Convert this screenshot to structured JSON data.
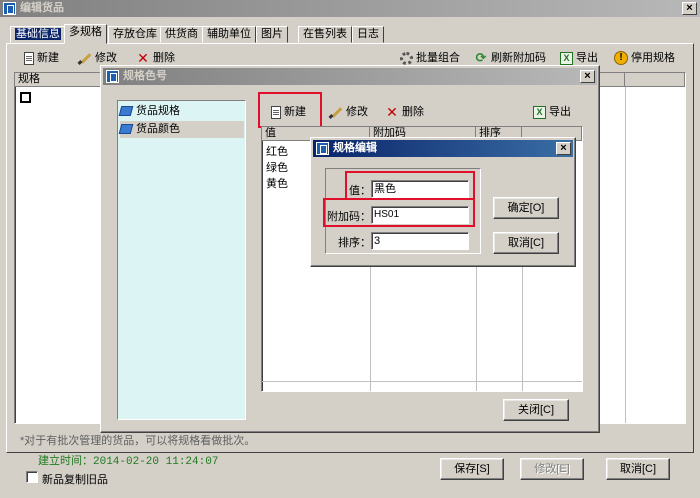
{
  "main_window": {
    "title": "编辑货品",
    "tabs": [
      "基础信息",
      "多规格",
      "存放仓库",
      "供货商",
      "辅助单位",
      "图片",
      "在售列表",
      "日志"
    ],
    "toolbar": {
      "new": "新建",
      "edit": "修改",
      "delete": "删除",
      "batch": "批量组合",
      "refresh_code": "刷新附加码",
      "export": "导出",
      "disable_spec": "停用规格"
    },
    "grid_header": "规格",
    "note": "*对于有批次管理的货品，可以将规格看做批次。",
    "created": "建立时间：2014-02-20 11:24:07",
    "copy_checkbox_label": "新品复制旧品",
    "buttons": {
      "save": "保存[S]",
      "modify": "修改[E]",
      "cancel": "取消[C]"
    }
  },
  "spec_dialog": {
    "title": "规格色号",
    "tree": [
      "货品规格",
      "货品颜色"
    ],
    "toolbar": {
      "new": "新建",
      "edit": "修改",
      "delete": "删除",
      "export": "导出"
    },
    "columns": [
      "值",
      "附加码",
      "排序"
    ],
    "rows": [
      "红色",
      "绿色",
      "黄色"
    ],
    "close": "关闭[C]"
  },
  "edit_dialog": {
    "title": "规格编辑",
    "value_label": "值：",
    "value": "黑色",
    "code_label": "附加码：",
    "code": "HS01",
    "order_label": "排序：",
    "order": "3",
    "ok": "确定[O]",
    "cancel": "取消[C]"
  },
  "colors": {
    "title_active": "#0a246a",
    "tree_bg": "#dcf4f4",
    "highlight": "#e0102a"
  }
}
